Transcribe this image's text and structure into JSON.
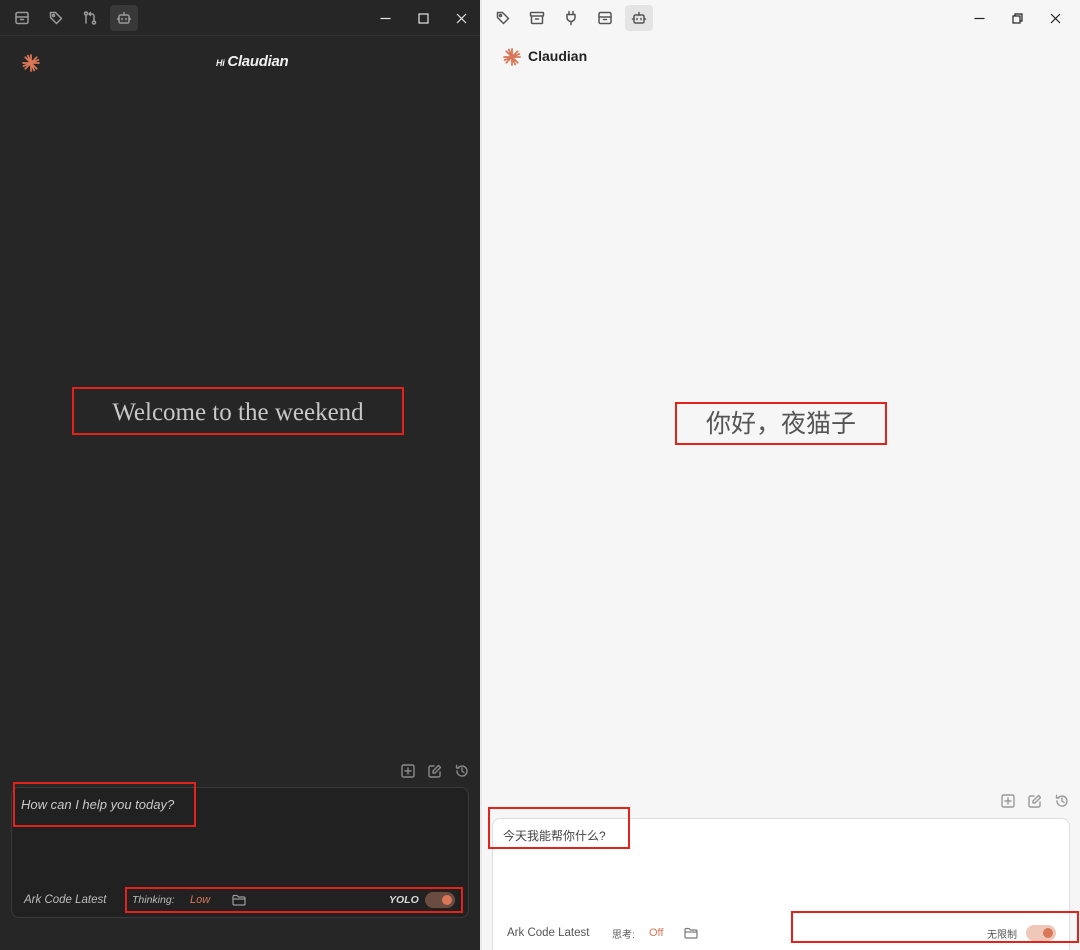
{
  "dark_pane": {
    "brand_prefix": "Hi",
    "brand_name": "Claudian",
    "welcome": "Welcome to the weekend",
    "input_placeholder": "How can I help you today?",
    "model": "Ark Code Latest",
    "thinking_label": "Thinking:",
    "thinking_value": "Low",
    "mode_label": "YOLO",
    "mode_enabled": true,
    "titlebar_icons": [
      "archive-icon",
      "tag-icon",
      "git-compare-icon",
      "bot-icon"
    ],
    "active_tab_icon": "bot-icon"
  },
  "light_pane": {
    "brand_name": "Claudian",
    "welcome": "你好，夜猫子",
    "input_placeholder": "今天我能帮你什么?",
    "model": "Ark Code Latest",
    "thinking_label": "思考:",
    "thinking_value": "Off",
    "mode_label": "无限制",
    "mode_enabled": true,
    "titlebar_icons": [
      "tag-icon",
      "archive-icon",
      "plug-icon",
      "inbox-icon",
      "bot-icon"
    ],
    "active_tab_icon": "bot-icon"
  },
  "colors": {
    "accent": "#d97757",
    "dark_background": "#262626",
    "light_background": "#f6f6f6",
    "highlight_box": "#e3231b"
  }
}
